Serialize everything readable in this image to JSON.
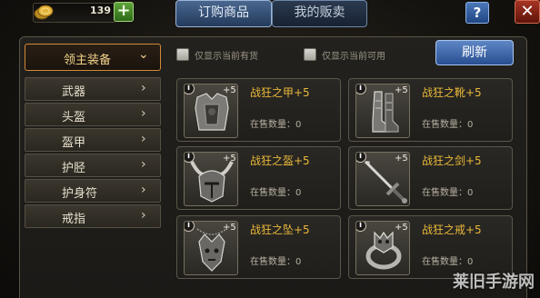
{
  "topbar": {
    "gold_value": "139",
    "add_gold_label": "+",
    "tabs": [
      {
        "label": "订购商品",
        "active": true
      },
      {
        "label": "我的贩卖",
        "active": false
      }
    ],
    "help_label": "?",
    "close_label": "✕"
  },
  "sidebar": {
    "header_label": "领主装备",
    "header_icon": "chevron-down-icon",
    "items": [
      {
        "label": "武器"
      },
      {
        "label": "头盔"
      },
      {
        "label": "盔甲"
      },
      {
        "label": "护胫"
      },
      {
        "label": "护身符"
      },
      {
        "label": "戒指"
      }
    ]
  },
  "filters": {
    "owned_only": "仅显示当前有货",
    "usable_only": "仅显示当前可用",
    "refresh_label": "刷新"
  },
  "items": [
    {
      "name": "战狂之甲+5",
      "stock": "在售数量：0",
      "upgrade": "+5",
      "info": "i",
      "icon": "armor-icon"
    },
    {
      "name": "战狂之靴+5",
      "stock": "在售数量：0",
      "upgrade": "+5",
      "info": "i",
      "icon": "boots-icon"
    },
    {
      "name": "战狂之盔+5",
      "stock": "在售数量：0",
      "upgrade": "+5",
      "info": "i",
      "icon": "helmet-icon"
    },
    {
      "name": "战狂之剑+5",
      "stock": "在售数量：0",
      "upgrade": "+5",
      "info": "i",
      "icon": "sword-icon"
    },
    {
      "name": "战狂之坠+5",
      "stock": "在售数量：0",
      "upgrade": "+5",
      "info": "i",
      "icon": "amulet-icon"
    },
    {
      "name": "战狂之戒+5",
      "stock": "在售数量：0",
      "upgrade": "+5",
      "info": "i",
      "icon": "ring-icon"
    }
  ],
  "watermark": "莱旧手游网",
  "colors": {
    "item_name": "#e9b93a",
    "category_accent": "#d08a35",
    "tab_active": "#4a678f",
    "refresh_button": "#5f86c4"
  }
}
